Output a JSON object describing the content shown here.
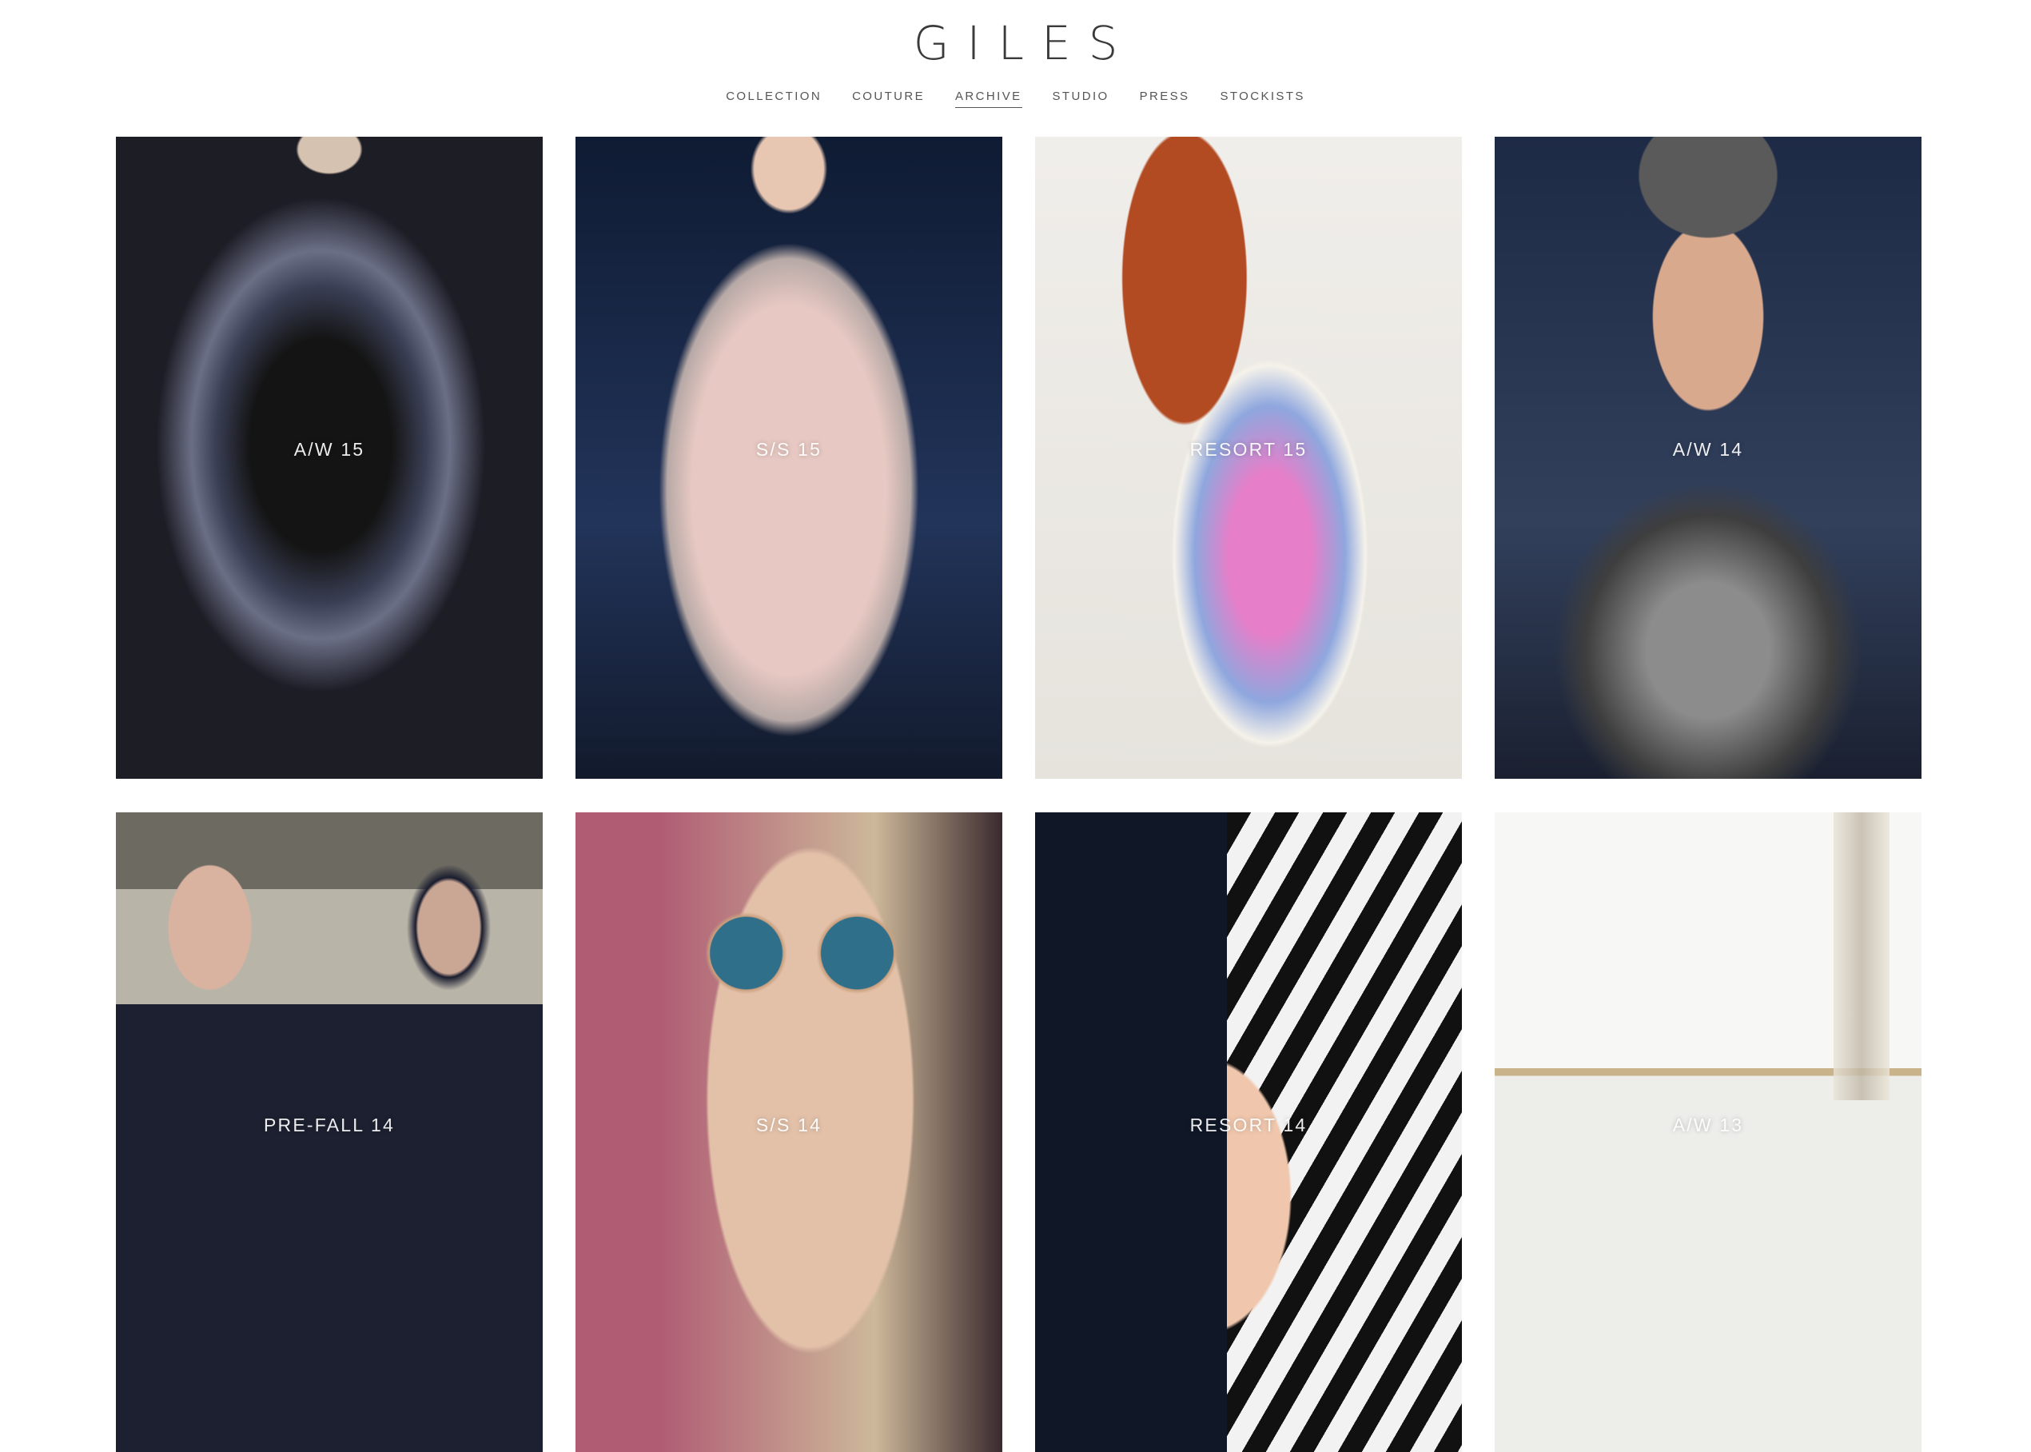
{
  "brand": {
    "logo": "GILES"
  },
  "nav": {
    "items": [
      {
        "label": "COLLECTION"
      },
      {
        "label": "COUTURE"
      },
      {
        "label": "ARCHIVE",
        "active": true
      },
      {
        "label": "STUDIO"
      },
      {
        "label": "PRESS"
      },
      {
        "label": "STOCKISTS"
      }
    ]
  },
  "archive": {
    "tiles": [
      {
        "label": "A/W 15"
      },
      {
        "label": "S/S 15"
      },
      {
        "label": "RESORT 15"
      },
      {
        "label": "A/W 14"
      },
      {
        "label": "PRE-FALL 14"
      },
      {
        "label": "S/S 14"
      },
      {
        "label": "RESORT 14"
      },
      {
        "label": "A/W 13"
      }
    ]
  },
  "colors": {
    "background": "#ffffff",
    "text": "#3a3a3a"
  }
}
